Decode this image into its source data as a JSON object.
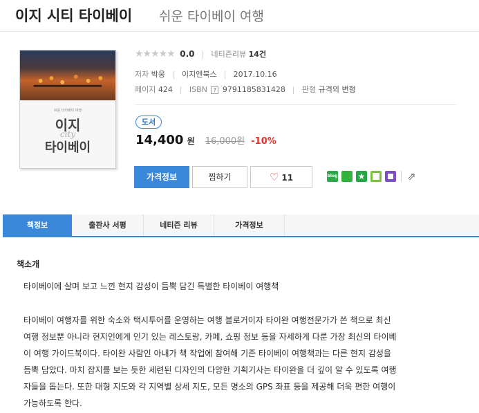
{
  "header": {
    "title": "이지 시티 타이베이",
    "subtitle": "쉬운 타이베이 여행"
  },
  "cover": {
    "small_text": "쉬운 타이베이 여행",
    "line1": "이지",
    "line2": "city",
    "line3": "타이베이"
  },
  "rating": {
    "stars": "★★★★★",
    "score": "0.0",
    "reviews_label": "네티즌리뷰",
    "reviews_count": "14건"
  },
  "meta": {
    "author_label": "저자",
    "author": "박웅",
    "publisher": "이지앤북스",
    "date": "2017.10.16",
    "pages_label": "페이지",
    "pages": "424",
    "isbn_label": "ISBN",
    "isbn_help": "?",
    "isbn": "9791185831428",
    "format_label": "판형",
    "format": "규격외 변형"
  },
  "badge": "도서",
  "price": {
    "sale": "14,400",
    "won": "원",
    "original": "16,000원",
    "discount": "-10%"
  },
  "buttons": {
    "price_info": "가격정보",
    "pick": "찜하기",
    "like_count": "11"
  },
  "share": {
    "blog": "blog",
    "more_icon": "share-out-icon"
  },
  "tabs": [
    {
      "label": "책정보"
    },
    {
      "label": "출판사 서평"
    },
    {
      "label": "네티즌 리뷰"
    },
    {
      "label": "가격정보"
    }
  ],
  "book_intro": {
    "title": "책소개",
    "headline": "타이베이에 살며 보고 느낀 현지 감성이 듬뿍 담긴 특별한 타이베이 여행책",
    "body_lines": [
      "타이베이 여행자를 위한 숙소와 택시투어를 운영하는 여행 블로거이자 타이완 여행전문가가 쓴 책으로 최신",
      "여행 정보뿐 아니라 현지인에게 인기 있는 레스토랑, 카페, 쇼핑 정보 등을 자세하게 다룬 가장 최신의 타이베",
      "이 여행 가이드북이다. 타이완 사람인 아내가 책 작업에 참여해 기존 타이베이 여행책과는 다른 현지 감성을",
      "듬뿍 담았다. 마치 잡지를 보는 듯한 세련된 디자인의 다양한 기획기사는 타이완을 더 깊이 알 수 있도록 여행",
      "자들을 돕는다. 또한 대형 지도와 각 지역별 상세 지도, 모든 명소의 GPS 좌표 등을 제공해 더욱 편한 여행이",
      "가능하도록 한다."
    ]
  }
}
